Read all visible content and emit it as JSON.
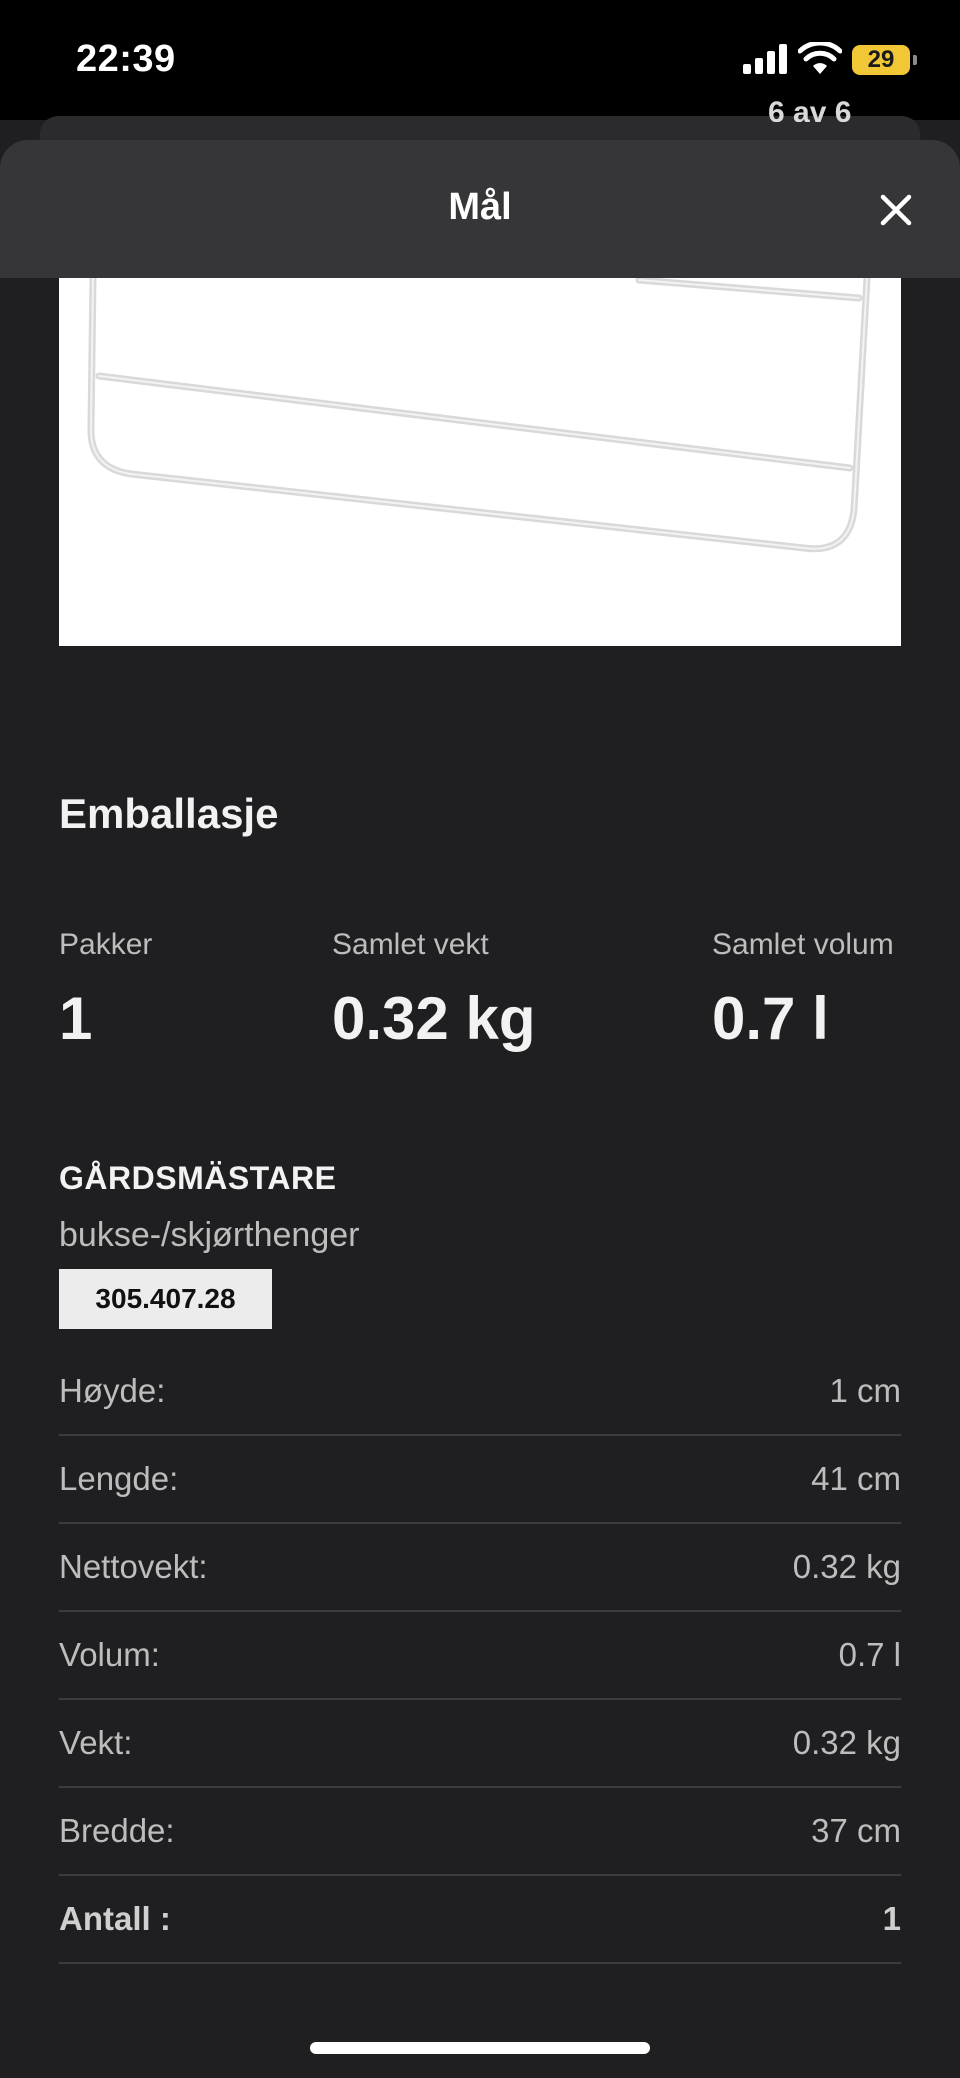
{
  "status_bar": {
    "time": "22:39",
    "battery": "29"
  },
  "background_card": {
    "text": "6 av 6"
  },
  "sheet": {
    "title": "Mål"
  },
  "packaging": {
    "title": "Emballasje",
    "summary": [
      {
        "label": "Pakker",
        "value": "1"
      },
      {
        "label": "Samlet vekt",
        "value": "0.32 kg"
      },
      {
        "label": "Samlet volum",
        "value": "0.7 l"
      }
    ]
  },
  "product": {
    "name": "GÅRDSMÄSTARE",
    "description": "bukse-/skjørthenger",
    "article_number": "305.407.28"
  },
  "specs": [
    {
      "label": "Høyde:",
      "value": "1 cm"
    },
    {
      "label": "Lengde:",
      "value": "41 cm"
    },
    {
      "label": "Nettovekt:",
      "value": "0.32 kg"
    },
    {
      "label": "Volum:",
      "value": "0.7 l"
    },
    {
      "label": "Vekt:",
      "value": "0.32 kg"
    },
    {
      "label": "Bredde:",
      "value": "37 cm"
    },
    {
      "label": "Antall :",
      "value": "1"
    }
  ],
  "colors": {
    "background": "#1f1f21",
    "header": "#363638",
    "battery": "#f2c736"
  }
}
